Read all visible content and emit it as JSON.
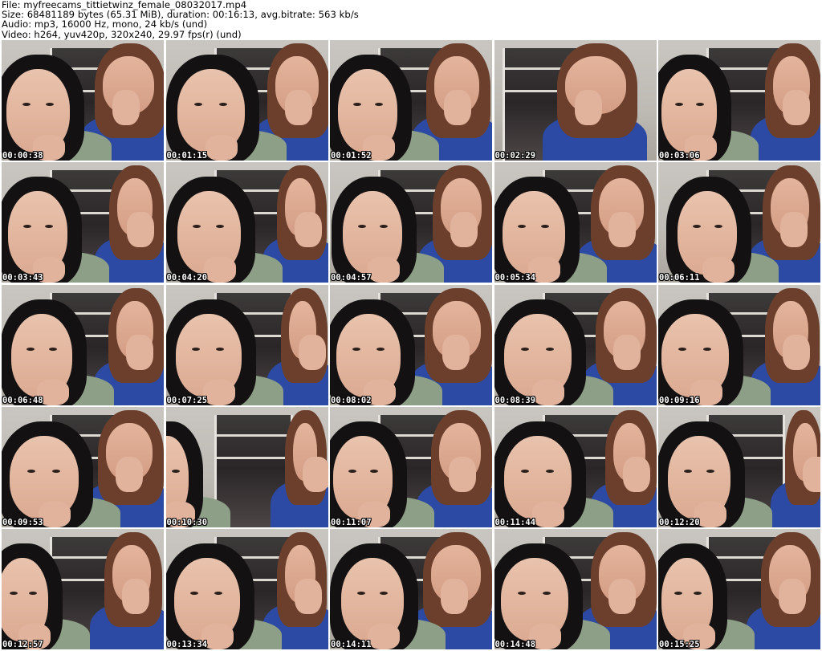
{
  "header": {
    "file_line": "File: myfreecams_tittietwinz_female_08032017.mp4",
    "size_line": "Size: 68481189 bytes (65.31 MiB), duration: 00:16:13, avg.bitrate: 563 kb/s",
    "audio_line": "Audio: mp3, 16000 Hz, mono, 24 kb/s (und)",
    "video_line": "Video: h264, yuv420p, 320x240, 29.97 fps(r) (und)"
  },
  "thumbnails": [
    {
      "timestamp": "00:00:38"
    },
    {
      "timestamp": "00:01:15"
    },
    {
      "timestamp": "00:01:52"
    },
    {
      "timestamp": "00:02:29"
    },
    {
      "timestamp": "00:03:06"
    },
    {
      "timestamp": "00:03:43"
    },
    {
      "timestamp": "00:04:20"
    },
    {
      "timestamp": "00:04:57"
    },
    {
      "timestamp": "00:05:34"
    },
    {
      "timestamp": "00:06:11"
    },
    {
      "timestamp": "00:06:48"
    },
    {
      "timestamp": "00:07:25"
    },
    {
      "timestamp": "00:08:02"
    },
    {
      "timestamp": "00:08:39"
    },
    {
      "timestamp": "00:09:16"
    },
    {
      "timestamp": "00:09:53"
    },
    {
      "timestamp": "00:10:30"
    },
    {
      "timestamp": "00:11:07"
    },
    {
      "timestamp": "00:11:44"
    },
    {
      "timestamp": "00:12:20"
    },
    {
      "timestamp": "00:12:57"
    },
    {
      "timestamp": "00:13:34"
    },
    {
      "timestamp": "00:14:11"
    },
    {
      "timestamp": "00:14:48"
    },
    {
      "timestamp": "00:15:25"
    }
  ],
  "colors": {
    "background": "#ffffff",
    "timestamp_text": "#ffffff",
    "timestamp_outline": "#000000"
  }
}
